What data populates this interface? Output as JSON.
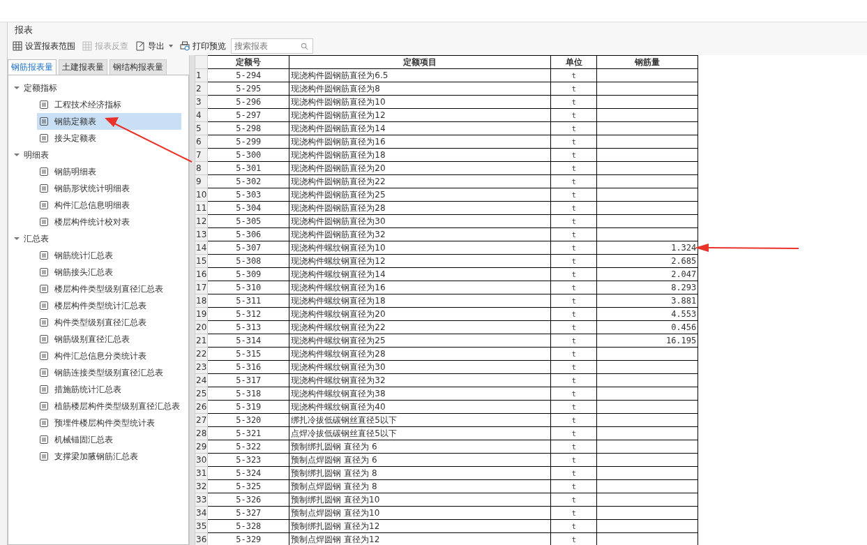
{
  "panel": {
    "title": "报表"
  },
  "toolbar": [
    {
      "kind": "grid",
      "label": "设置报表范围",
      "disabled": false
    },
    {
      "kind": "grid",
      "label": "报表反查",
      "disabled": true
    },
    {
      "kind": "export",
      "label": "导出",
      "disabled": false,
      "dropdown": true
    },
    {
      "kind": "print",
      "label": "打印预览",
      "disabled": false
    }
  ],
  "search": {
    "placeholder": "搜索报表"
  },
  "tabs": [
    {
      "label": "钢筋报表量",
      "selected": true
    },
    {
      "label": "土建报表量",
      "selected": false
    },
    {
      "label": "钢结构报表量",
      "selected": false
    }
  ],
  "tree": [
    {
      "label": "定额指标",
      "expanded": true,
      "children": [
        {
          "label": "工程技术经济指标",
          "selected": false
        },
        {
          "label": "钢筋定额表",
          "selected": true
        },
        {
          "label": "接头定额表",
          "selected": false
        }
      ]
    },
    {
      "label": "明细表",
      "expanded": true,
      "children": [
        {
          "label": "钢筋明细表",
          "selected": false
        },
        {
          "label": "钢筋形状统计明细表",
          "selected": false
        },
        {
          "label": "构件汇总信息明细表",
          "selected": false
        },
        {
          "label": "楼层构件统计校对表",
          "selected": false
        }
      ]
    },
    {
      "label": "汇总表",
      "expanded": true,
      "children": [
        {
          "label": "钢筋统计汇总表",
          "selected": false
        },
        {
          "label": "钢筋接头汇总表",
          "selected": false
        },
        {
          "label": "楼层构件类型级别直径汇总表",
          "selected": false
        },
        {
          "label": "楼层构件类型统计汇总表",
          "selected": false
        },
        {
          "label": "构件类型级别直径汇总表",
          "selected": false
        },
        {
          "label": "钢筋级别直径汇总表",
          "selected": false
        },
        {
          "label": "构件汇总信息分类统计表",
          "selected": false
        },
        {
          "label": "钢筋连接类型级别直径汇总表",
          "selected": false
        },
        {
          "label": "措施筋统计汇总表",
          "selected": false
        },
        {
          "label": "植筋楼层构件类型级别直径汇总表",
          "selected": false
        },
        {
          "label": "预埋件楼层构件类型统计表",
          "selected": false
        },
        {
          "label": "机械锚固汇总表",
          "selected": false
        },
        {
          "label": "支撑梁加腋钢筋汇总表",
          "selected": false
        }
      ]
    }
  ],
  "table": {
    "columns": [
      "",
      "定额号",
      "定额项目",
      "单位",
      "钢筋量"
    ],
    "rows": [
      [
        "1",
        "5-294",
        "现浇构件圆钢筋直径为6.5",
        "t",
        ""
      ],
      [
        "2",
        "5-295",
        "现浇构件圆钢筋直径为8",
        "t",
        ""
      ],
      [
        "3",
        "5-296",
        "现浇构件圆钢筋直径为10",
        "t",
        ""
      ],
      [
        "4",
        "5-297",
        "现浇构件圆钢筋直径为12",
        "t",
        ""
      ],
      [
        "5",
        "5-298",
        "现浇构件圆钢筋直径为14",
        "t",
        ""
      ],
      [
        "6",
        "5-299",
        "现浇构件圆钢筋直径为16",
        "t",
        ""
      ],
      [
        "7",
        "5-300",
        "现浇构件圆钢筋直径为18",
        "t",
        ""
      ],
      [
        "8",
        "5-301",
        "现浇构件圆钢筋直径为20",
        "t",
        ""
      ],
      [
        "9",
        "5-302",
        "现浇构件圆钢筋直径为22",
        "t",
        ""
      ],
      [
        "10",
        "5-303",
        "现浇构件圆钢筋直径为25",
        "t",
        ""
      ],
      [
        "11",
        "5-304",
        "现浇构件圆钢筋直径为28",
        "t",
        ""
      ],
      [
        "12",
        "5-305",
        "现浇构件圆钢筋直径为30",
        "t",
        ""
      ],
      [
        "13",
        "5-306",
        "现浇构件圆钢筋直径为32",
        "t",
        ""
      ],
      [
        "14",
        "5-307",
        "现浇构件螺纹钢直径为10",
        "t",
        "1.324"
      ],
      [
        "15",
        "5-308",
        "现浇构件螺纹钢直径为12",
        "t",
        "2.685"
      ],
      [
        "16",
        "5-309",
        "现浇构件螺纹钢直径为14",
        "t",
        "2.047"
      ],
      [
        "17",
        "5-310",
        "现浇构件螺纹钢直径为16",
        "t",
        "8.293"
      ],
      [
        "18",
        "5-311",
        "现浇构件螺纹钢直径为18",
        "t",
        "3.881"
      ],
      [
        "19",
        "5-312",
        "现浇构件螺纹钢直径为20",
        "t",
        "4.553"
      ],
      [
        "20",
        "5-313",
        "现浇构件螺纹钢直径为22",
        "t",
        "0.456"
      ],
      [
        "21",
        "5-314",
        "现浇构件螺纹钢直径为25",
        "t",
        "16.195"
      ],
      [
        "22",
        "5-315",
        "现浇构件螺纹钢直径为28",
        "t",
        ""
      ],
      [
        "23",
        "5-316",
        "现浇构件螺纹钢直径为30",
        "t",
        ""
      ],
      [
        "24",
        "5-317",
        "现浇构件螺纹钢直径为32",
        "t",
        ""
      ],
      [
        "25",
        "5-318",
        "现浇构件螺纹钢直径为38",
        "t",
        ""
      ],
      [
        "26",
        "5-319",
        "现浇构件螺纹钢直径为40",
        "t",
        ""
      ],
      [
        "27",
        "5-320",
        "绑扎冷拔低碳钢丝直径5以下",
        "t",
        ""
      ],
      [
        "28",
        "5-321",
        "点焊冷拔低碳钢丝直径5以下",
        "t",
        ""
      ],
      [
        "29",
        "5-322",
        "预制绑扎圆钢 直径为 6",
        "t",
        ""
      ],
      [
        "30",
        "5-323",
        "预制点焊圆钢 直径为 6",
        "t",
        ""
      ],
      [
        "31",
        "5-324",
        "预制绑扎圆钢 直径为 8",
        "t",
        ""
      ],
      [
        "32",
        "5-325",
        "预制点焊圆钢 直径为 8",
        "t",
        ""
      ],
      [
        "33",
        "5-326",
        "预制绑扎圆钢 直径为10",
        "t",
        ""
      ],
      [
        "34",
        "5-327",
        "预制点焊圆钢 直径为10",
        "t",
        ""
      ],
      [
        "35",
        "5-328",
        "预制绑扎圆钢 直径为12",
        "t",
        ""
      ],
      [
        "36",
        "5-329",
        "预制点焊圆钢 直径为12",
        "t",
        ""
      ]
    ]
  }
}
